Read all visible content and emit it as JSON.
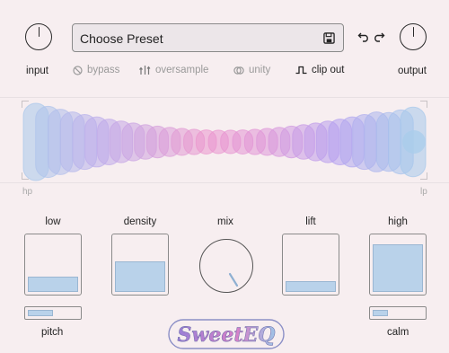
{
  "header": {
    "input_label": "input",
    "output_label": "output",
    "preset_label": "Choose Preset",
    "undo_icon": "undo-icon",
    "redo_icon": "redo-icon",
    "save_icon": "save-icon"
  },
  "options": {
    "bypass": "bypass",
    "oversample": "oversample",
    "unity": "unity",
    "clip_out": "clip out"
  },
  "eq": {
    "left_label": "hp",
    "right_label": "lp"
  },
  "bands": {
    "low": {
      "label": "low",
      "level": 0.27
    },
    "density": {
      "label": "density",
      "level": 0.55
    },
    "mix": {
      "label": "mix"
    },
    "lift": {
      "label": "lift",
      "level": 0.2
    },
    "high": {
      "label": "high",
      "level": 0.85
    }
  },
  "bottom": {
    "pitch_label": "pitch",
    "pitch_level": 0.5,
    "calm_label": "calm",
    "calm_level": 0.3
  },
  "brand": {
    "logo_text": "SweetEQ"
  },
  "colors": {
    "background": "#f7eef0",
    "fill_blue": "#b9d2ea",
    "muted_text": "#9a9a9a"
  }
}
